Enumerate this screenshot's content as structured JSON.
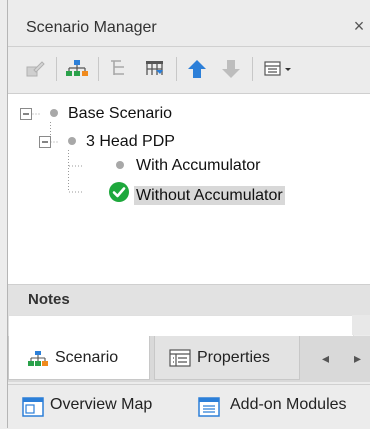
{
  "panel": {
    "title": "Scenario Manager",
    "close_glyph": "×"
  },
  "toolbar": {
    "buttons": [
      {
        "icon": "edit-scenario-icon",
        "enabled": false
      },
      {
        "icon": "org-chart-icon",
        "enabled": true
      },
      {
        "icon": "tree-list-icon",
        "enabled": false
      },
      {
        "icon": "filter-list-icon",
        "enabled": true
      },
      {
        "icon": "move-up-icon",
        "enabled": true
      },
      {
        "icon": "move-down-icon",
        "enabled": false
      },
      {
        "icon": "view-options-icon",
        "enabled": true
      }
    ]
  },
  "tree": {
    "expander_minus": "−",
    "items": [
      {
        "label": "Base Scenario",
        "level": 0,
        "status": "inactive"
      },
      {
        "label": "3 Head PDP",
        "level": 1,
        "status": "inactive"
      },
      {
        "label": "With Accumulator",
        "level": 2,
        "status": "inactive"
      },
      {
        "label": "Without Accumulator",
        "level": 2,
        "status": "active"
      }
    ]
  },
  "notes": {
    "title": "Notes",
    "value": ""
  },
  "tabs": [
    {
      "label": "Scenario",
      "icon": "scenario-tree-icon",
      "active": true
    },
    {
      "label": "Properties",
      "icon": "properties-grid-icon",
      "active": false
    }
  ],
  "tab_scroll": {
    "left": "◂",
    "right": "▸"
  },
  "bottom": {
    "buttons": [
      {
        "label": "Overview Map",
        "icon": "overview-map-icon"
      },
      {
        "label": "Add-on Modules",
        "icon": "addon-modules-icon"
      }
    ]
  },
  "colors": {
    "accent_blue": "#2c7fd8",
    "active_green": "#1ea83c",
    "dot_gray": "#a8a8a8"
  }
}
